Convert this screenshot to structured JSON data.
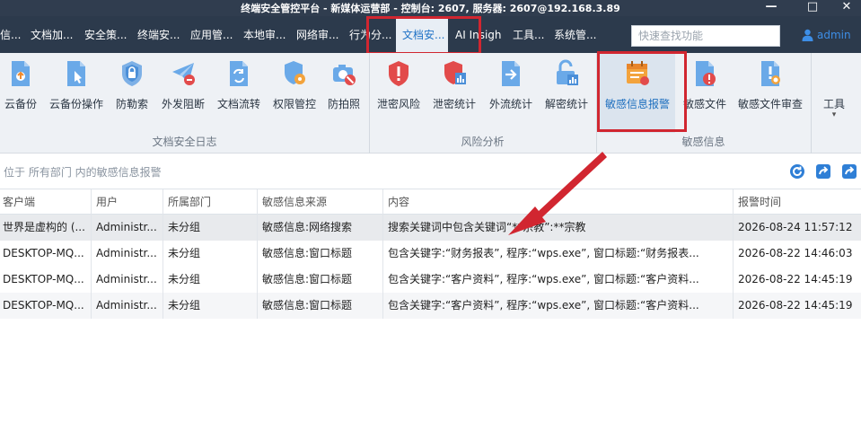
{
  "titlebar": {
    "title": "终端安全管控平台 - 新媒体运营部 - 控制台: 2607, 服务器: 2607@192.168.3.89",
    "minimize": "—",
    "maximize": "□",
    "close": "✕"
  },
  "menu": {
    "items": [
      "信...",
      "文档加...",
      "安全策...",
      "终端安...",
      "应用管...",
      "本地审...",
      "网络审...",
      "行为分...",
      "文档安...",
      "AI Insigh",
      "工具...",
      "系统管..."
    ],
    "search_placeholder": "快速查找功能",
    "user": "admin"
  },
  "ribbon": {
    "buttons": [
      "云备份",
      "云备份操作",
      "防勒索",
      "外发阻断",
      "文档流转",
      "权限管控",
      "防拍照",
      "泄密风险",
      "泄密统计",
      "外流统计",
      "解密统计",
      "敏感信息报警",
      "敏感文件",
      "敏感文件审查",
      "工具"
    ],
    "tools_caret": "▾",
    "groups": [
      "文档安全日志",
      "风险分析",
      "敏感信息"
    ]
  },
  "location": "位于 所有部门 内的敏感信息报警",
  "table": {
    "headers": [
      "客户端",
      "用户",
      "所属部门",
      "敏感信息来源",
      "内容",
      "报警时间"
    ],
    "rows": [
      [
        "世界是虚构的 (...",
        "Administr...",
        "未分组",
        "敏感信息:网络搜索",
        "搜索关键词中包含关键词“**宗教”:**宗教",
        "2026-08-24 11:57:12"
      ],
      [
        "DESKTOP-MQ...",
        "Administr...",
        "未分组",
        "敏感信息:窗口标题",
        "包含关键字:“财务报表”, 程序:“wps.exe”, 窗口标题:“财务报表...",
        "2026-08-22 14:46:03"
      ],
      [
        "DESKTOP-MQ...",
        "Administr...",
        "未分组",
        "敏感信息:窗口标题",
        "包含关键字:“客户资料”, 程序:“wps.exe”, 窗口标题:“客户资料...",
        "2026-08-22 14:45:19"
      ],
      [
        "DESKTOP-MQ...",
        "Administr...",
        "未分组",
        "敏感信息:窗口标题",
        "包含关键字:“客户资料”, 程序:“wps.exe”, 窗口标题:“客户资料...",
        "2026-08-22 14:45:19"
      ]
    ]
  },
  "colors": {
    "accent": "#1f72c6",
    "menubar": "#2c3a4c",
    "highlight": "#d12630"
  }
}
